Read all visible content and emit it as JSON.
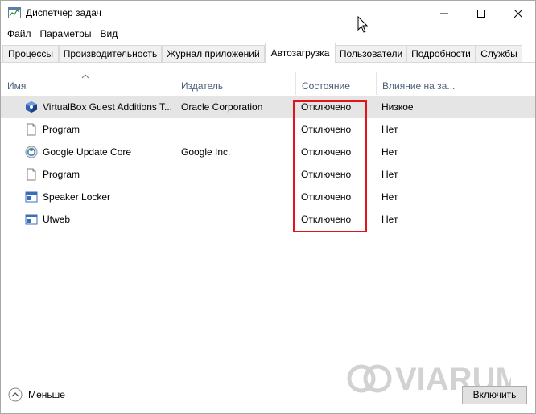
{
  "window": {
    "title": "Диспетчер задач"
  },
  "menu": [
    "Файл",
    "Параметры",
    "Вид"
  ],
  "tabs": [
    {
      "label": "Процессы"
    },
    {
      "label": "Производительность"
    },
    {
      "label": "Журнал приложений"
    },
    {
      "label": "Автозагрузка",
      "active": true
    },
    {
      "label": "Пользователи"
    },
    {
      "label": "Подробности"
    },
    {
      "label": "Службы"
    }
  ],
  "table": {
    "columns": {
      "name": "Имя",
      "publisher": "Издатель",
      "status": "Состояние",
      "impact": "Влияние на за..."
    },
    "rows": [
      {
        "icon": "virtualbox-icon",
        "name": "VirtualBox Guest Additions T...",
        "publisher": "Oracle Corporation",
        "status": "Отключено",
        "impact": "Низкое",
        "selected": true
      },
      {
        "icon": "document-icon",
        "name": "Program",
        "publisher": "",
        "status": "Отключено",
        "impact": "Нет"
      },
      {
        "icon": "google-update-icon",
        "name": "Google Update Core",
        "publisher": "Google Inc.",
        "status": "Отключено",
        "impact": "Нет"
      },
      {
        "icon": "document-icon",
        "name": "Program",
        "publisher": "",
        "status": "Отключено",
        "impact": "Нет"
      },
      {
        "icon": "app-window-icon",
        "name": "Speaker Locker",
        "publisher": "",
        "status": "Отключено",
        "impact": "Нет"
      },
      {
        "icon": "app-window-icon",
        "name": "Utweb",
        "publisher": "",
        "status": "Отключено",
        "impact": "Нет"
      }
    ]
  },
  "watermark": "VIARUM",
  "footer": {
    "fewer_label": "Меньше",
    "enable_label": "Включить"
  },
  "colors": {
    "highlight_border": "#e0141f",
    "selected_row": "#e5e5e5",
    "header_text": "#4c607a"
  }
}
